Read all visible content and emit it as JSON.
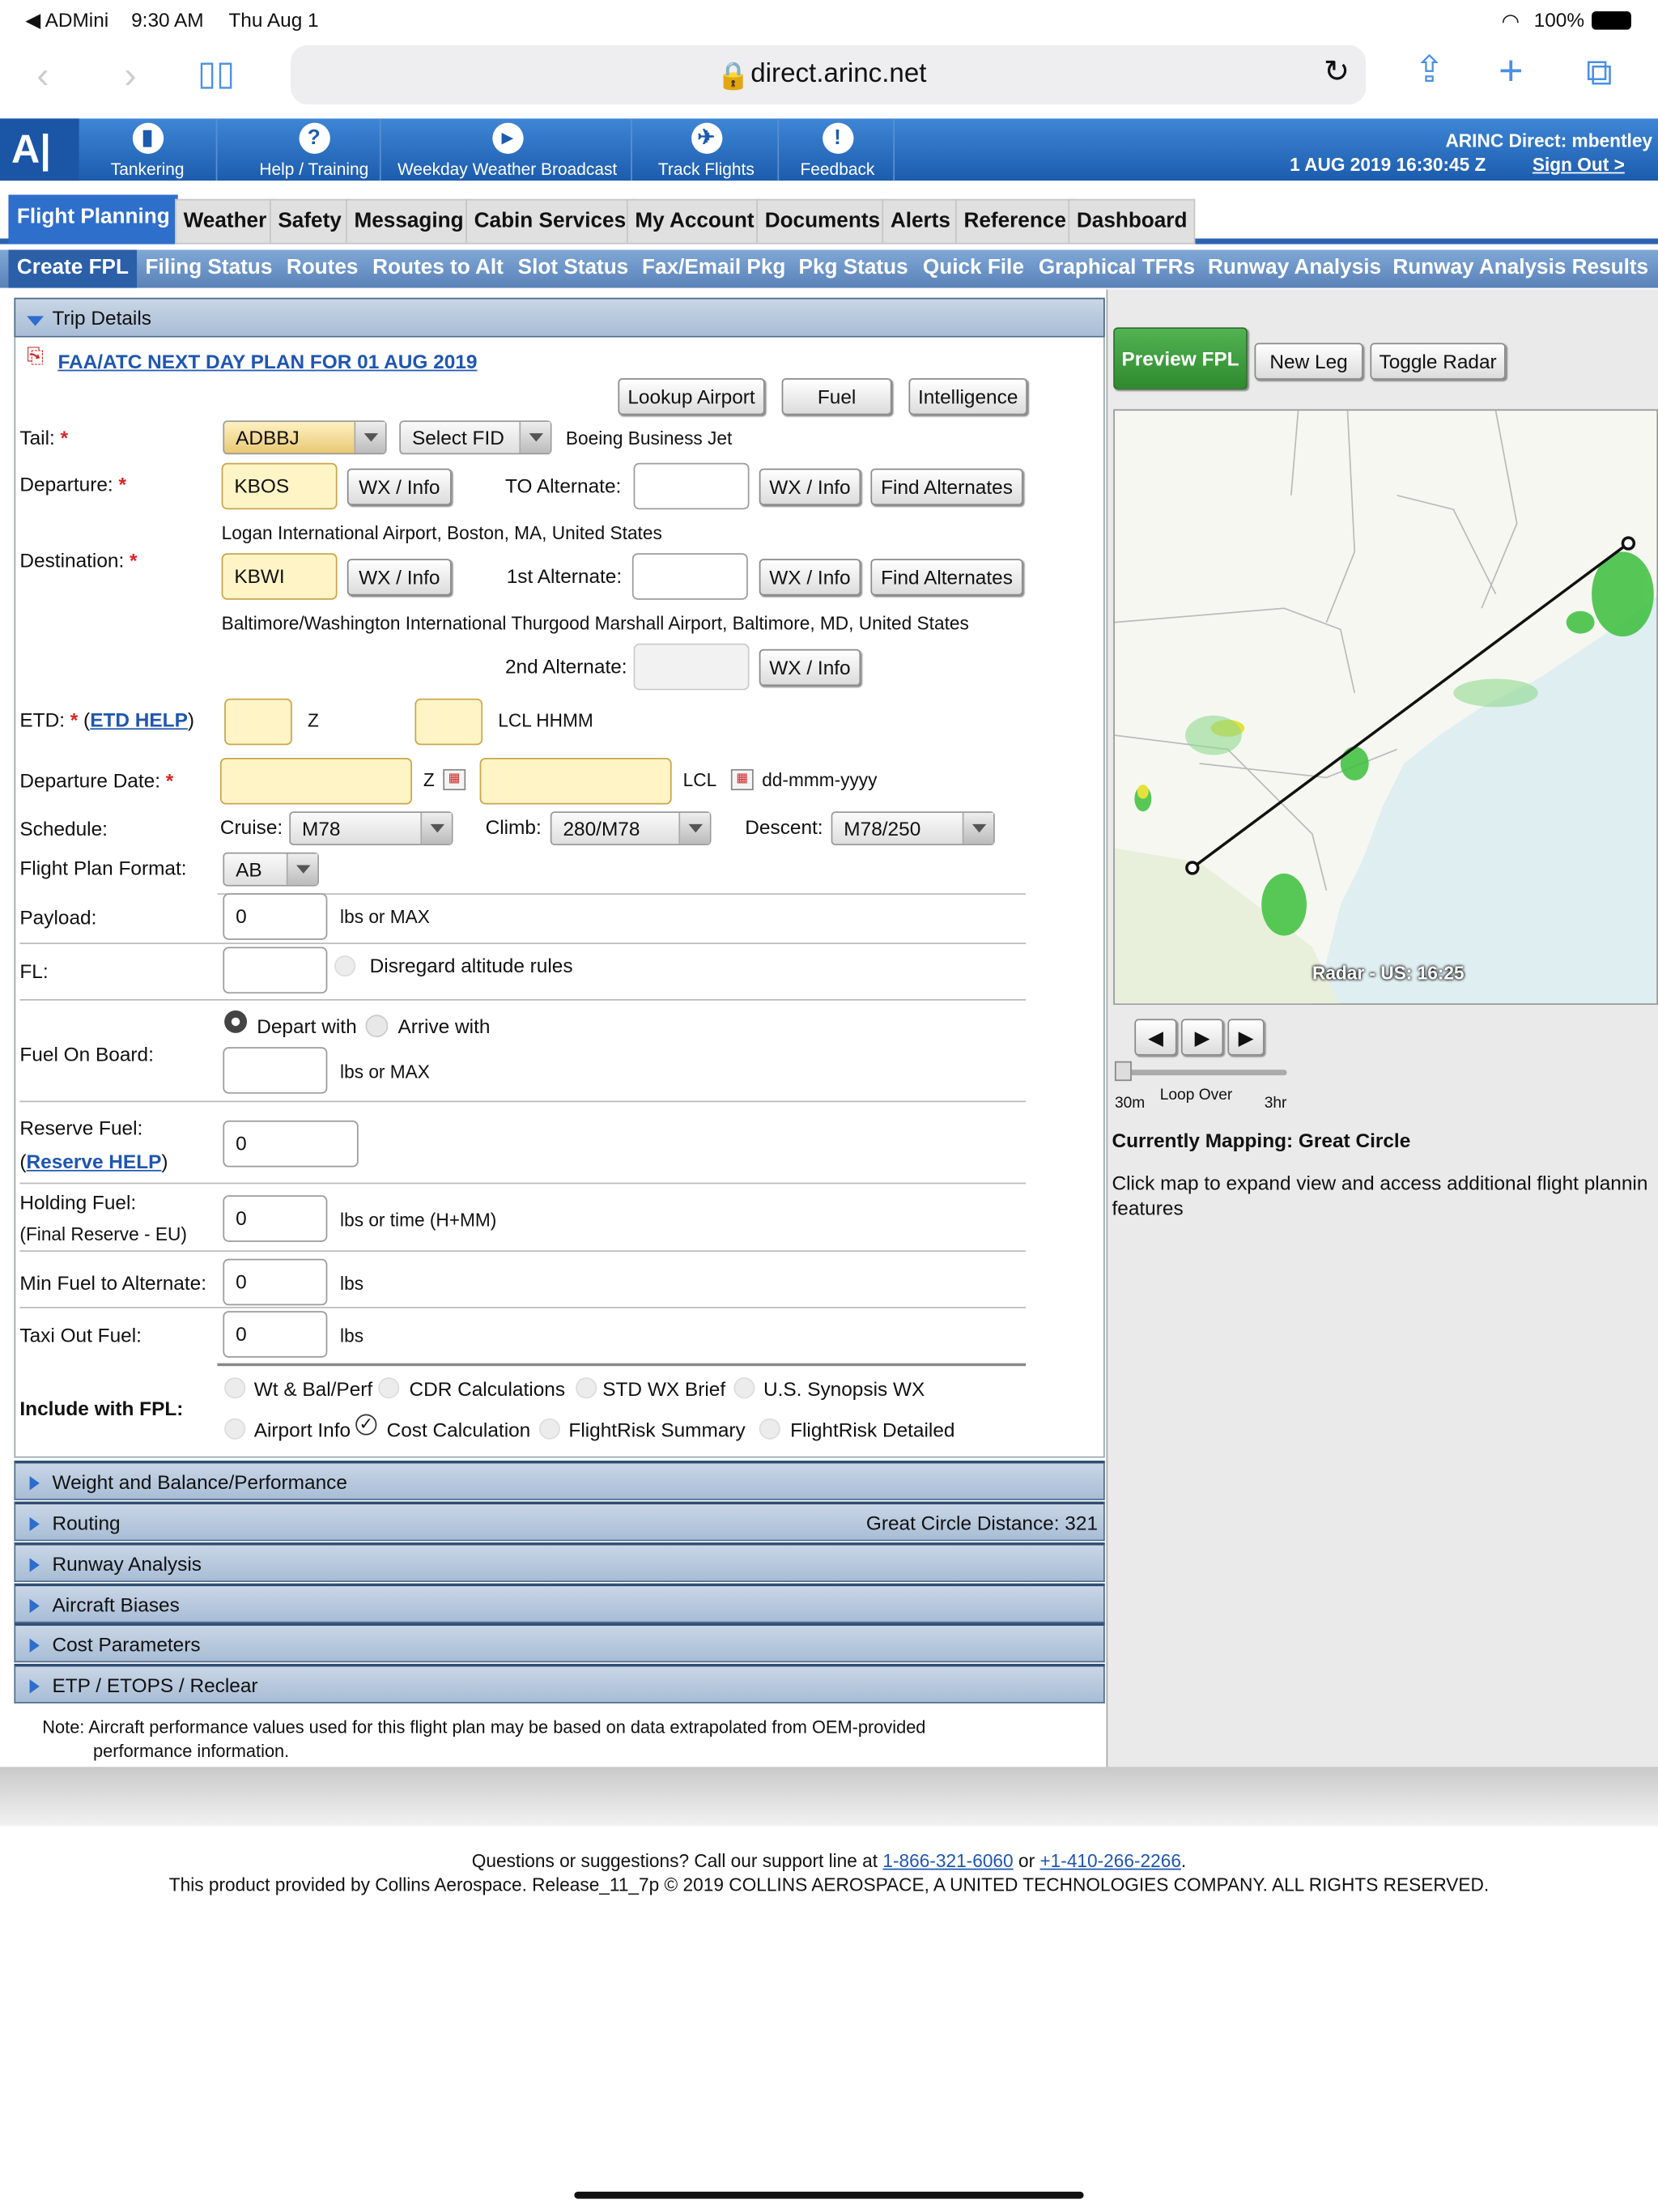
{
  "status": {
    "back": "◀ ADMini",
    "time": "9:30 AM",
    "date": "Thu Aug 1",
    "battery": "100%"
  },
  "browser": {
    "url": "direct.arinc.net"
  },
  "header": {
    "items": [
      "Tankering",
      "Help / Training",
      "Weekday Weather Broadcast",
      "Track Flights",
      "Feedback"
    ],
    "user": "ARINC Direct: mbentley",
    "datetime": "1 AUG 2019 16:30:45 Z",
    "signout": "Sign Out >"
  },
  "tabs": [
    "Flight Planning",
    "Weather",
    "Safety",
    "Messaging",
    "Cabin Services",
    "My Account",
    "Documents",
    "Alerts",
    "Reference",
    "Dashboard"
  ],
  "subtabs": [
    "Create FPL",
    "Filing Status",
    "Routes",
    "Routes to Alt",
    "Slot Status",
    "Fax/Email Pkg",
    "Pkg Status",
    "Quick File",
    "Graphical TFRs",
    "Runway Analysis",
    "Runway Analysis Results"
  ],
  "trip": {
    "title": "Trip Details",
    "plan_link": "FAA/ATC NEXT DAY PLAN FOR 01 AUG 2019",
    "lookup": "Lookup Airport",
    "fuel": "Fuel",
    "intel": "Intelligence",
    "tail_label": "Tail:",
    "tail": "ADBBJ",
    "select_fid": "Select FID",
    "aircraft": "Boeing Business Jet",
    "dep_label": "Departure:",
    "dep": "KBOS",
    "wx": "WX / Info",
    "to_alt_label": "TO Alternate:",
    "find_alt": "Find Alternates",
    "dep_name": "Logan International Airport, Boston, MA, United States",
    "dest_label": "Destination:",
    "dest": "KBWI",
    "alt1_label": "1st Alternate:",
    "dest_name": "Baltimore/Washington International Thurgood Marshall Airport, Baltimore, MD, United States",
    "alt2_label": "2nd Alternate:",
    "etd_label": "ETD:",
    "etd_help": "ETD HELP",
    "z": "Z",
    "lcl_hhmm": "LCL HHMM",
    "date_label": "Departure Date:",
    "lcl": "LCL",
    "date_fmt": "dd-mmm-yyyy",
    "sched_label": "Schedule:",
    "cruise_label": "Cruise:",
    "cruise": "M78",
    "climb_label": "Climb:",
    "climb": "280/M78",
    "descent_label": "Descent:",
    "descent": "M78/250",
    "format_label": "Flight Plan Format:",
    "format": "AB",
    "payload_label": "Payload:",
    "payload": "0",
    "lbs_max": "lbs or MAX",
    "fl_label": "FL:",
    "disregard": "Disregard altitude rules",
    "fob_label": "Fuel On Board:",
    "depart_with": "Depart with",
    "arrive_with": "Arrive with",
    "reserve_label": "Reserve Fuel:",
    "reserve_help": "Reserve HELP",
    "reserve": "0",
    "holding_label": "Holding Fuel:",
    "holding_sub": "(Final Reserve - EU)",
    "holding": "0",
    "lbs_time": "lbs or time (H+MM)",
    "minfuel_label": "Min Fuel to Alternate:",
    "minfuel": "0",
    "lbs": "lbs",
    "taxi_label": "Taxi Out Fuel:",
    "taxi": "0",
    "include_label": "Include with FPL:",
    "inc": [
      "Wt & Bal/Perf",
      "CDR Calculations",
      "STD WX Brief",
      "U.S. Synopsis WX",
      "Airport Info",
      "Cost Calculation",
      "FlightRisk Summary",
      "FlightRisk Detailed"
    ]
  },
  "sections": [
    "Weight and Balance/Performance",
    "Routing",
    "Runway Analysis",
    "Aircraft Biases",
    "Cost Parameters",
    "ETP / ETOPS / Reclear"
  ],
  "gcd": "Great Circle Distance: 321",
  "note1": "Note: Aircraft performance values used for this flight plan may be based on data extrapolated from OEM-provided",
  "note2": "performance information.",
  "right": {
    "preview": "Preview FPL",
    "newleg": "New Leg",
    "toggle": "Toggle Radar",
    "radar_label": "Radar - US: 16:25",
    "t30": "30m",
    "loop": "Loop Over",
    "t3": "3hr",
    "mapping": "Currently Mapping: Great Circle",
    "click": "Click map to expand view and access additional flight plannin",
    "features": "features"
  },
  "footer": {
    "q": "Questions or suggestions? Call our support line at",
    "phone1": "1-866-321-6060",
    "or": "or",
    "phone2": "+1-410-266-2266",
    "copy": "This product provided by Collins Aerospace. Release_11_7p © 2019 COLLINS AEROSPACE, A UNITED TECHNOLOGIES COMPANY. ALL RIGHTS RESERVED."
  },
  "colors": {
    "accent": "#2e6fcb",
    "header": "#1c5cad",
    "required": "#d22222",
    "input_yellow": "#fff4c6",
    "preview_green": "#3a9a3a"
  }
}
